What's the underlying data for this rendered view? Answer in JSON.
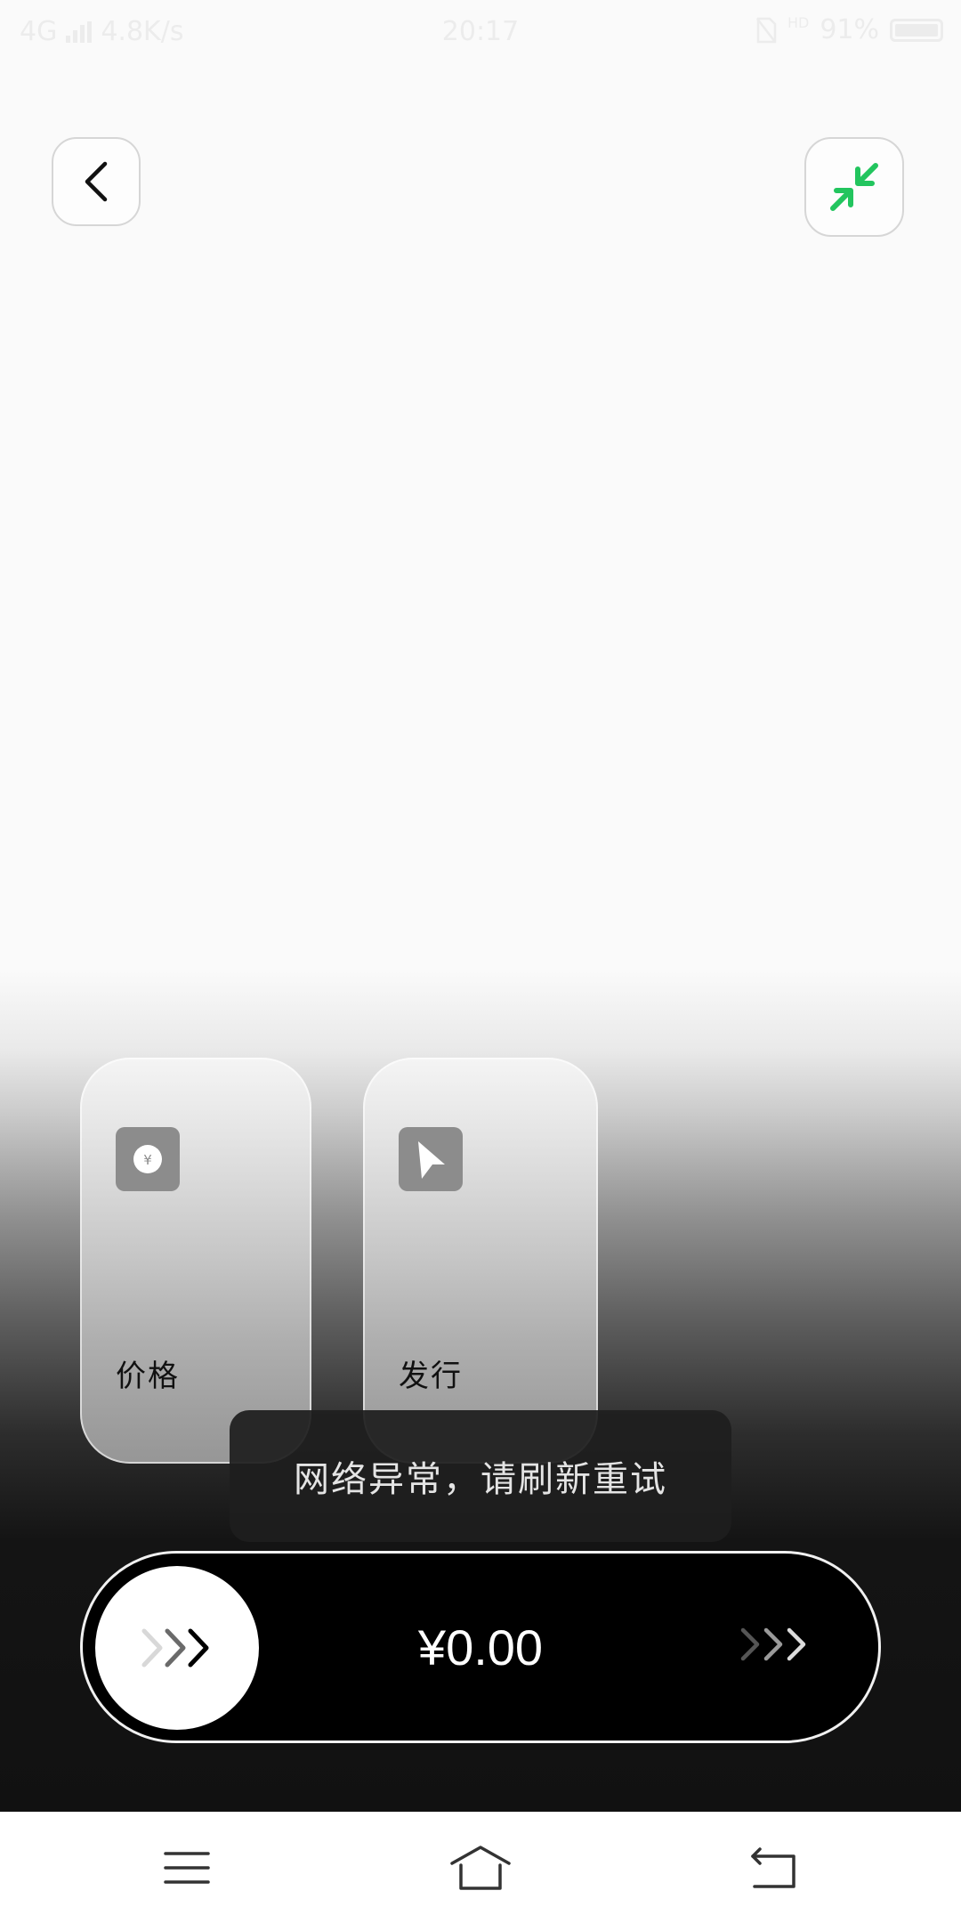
{
  "status_bar": {
    "network": "4G",
    "speed": "4.8K/s",
    "time": "20:17",
    "hd_label": "HD",
    "battery": "91%"
  },
  "header": {
    "back_icon": "chevron-left-icon",
    "collapse_icon": "collapse-arrows-icon",
    "accent_color": "#22c55e"
  },
  "cards": [
    {
      "label": "价格",
      "icon": "yuan-coin-icon"
    },
    {
      "label": "发行",
      "icon": "send-arrow-icon"
    }
  ],
  "toast": {
    "message": "网络异常，请刷新重试"
  },
  "slider": {
    "amount": "¥0.00",
    "knob_icon": "triple-chevron-right-icon"
  },
  "nav_bar": {
    "menu_icon": "menu-icon",
    "home_icon": "home-icon",
    "back_icon": "return-icon"
  }
}
